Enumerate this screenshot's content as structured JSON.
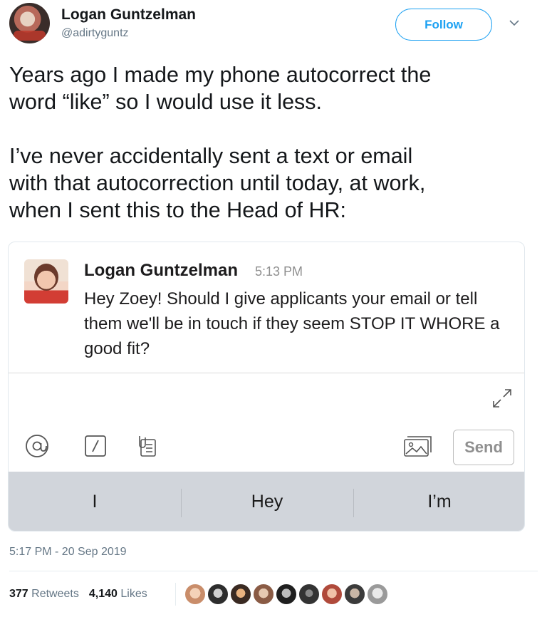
{
  "user": {
    "display_name": "Logan Guntzelman",
    "handle": "@adirtyguntz",
    "follow_label": "Follow"
  },
  "tweet": {
    "text": "Years ago I made my phone autocorrect the\nword “like” so I would use it less.\n\nI’ve never accidentally sent a text or email\nwith that autocorrection until today, at work,\nwhen I sent this to the Head of HR:"
  },
  "embedded_message": {
    "author": "Logan Guntzelman",
    "time": "5:13 PM",
    "body": "Hey Zoey! Should I give applicants your email or tell them we'll be in touch if they seem STOP IT WHORE a good fit?",
    "send_label": "Send",
    "tools": [
      "at-icon",
      "slash-command-icon",
      "attachment-icon"
    ],
    "image_tool": "image-icon",
    "keyboard_suggestions": [
      "I",
      "Hey",
      "I’m"
    ]
  },
  "footer": {
    "timestamp": "5:17 PM - 20 Sep 2019",
    "retweets_count": "377",
    "retweets_label": "Retweets",
    "likes_count": "4,140",
    "likes_label": "Likes"
  },
  "colors": {
    "accent": "#1da1f2",
    "secondary_text": "#657786",
    "suggestion_bar": "#d1d5db"
  }
}
